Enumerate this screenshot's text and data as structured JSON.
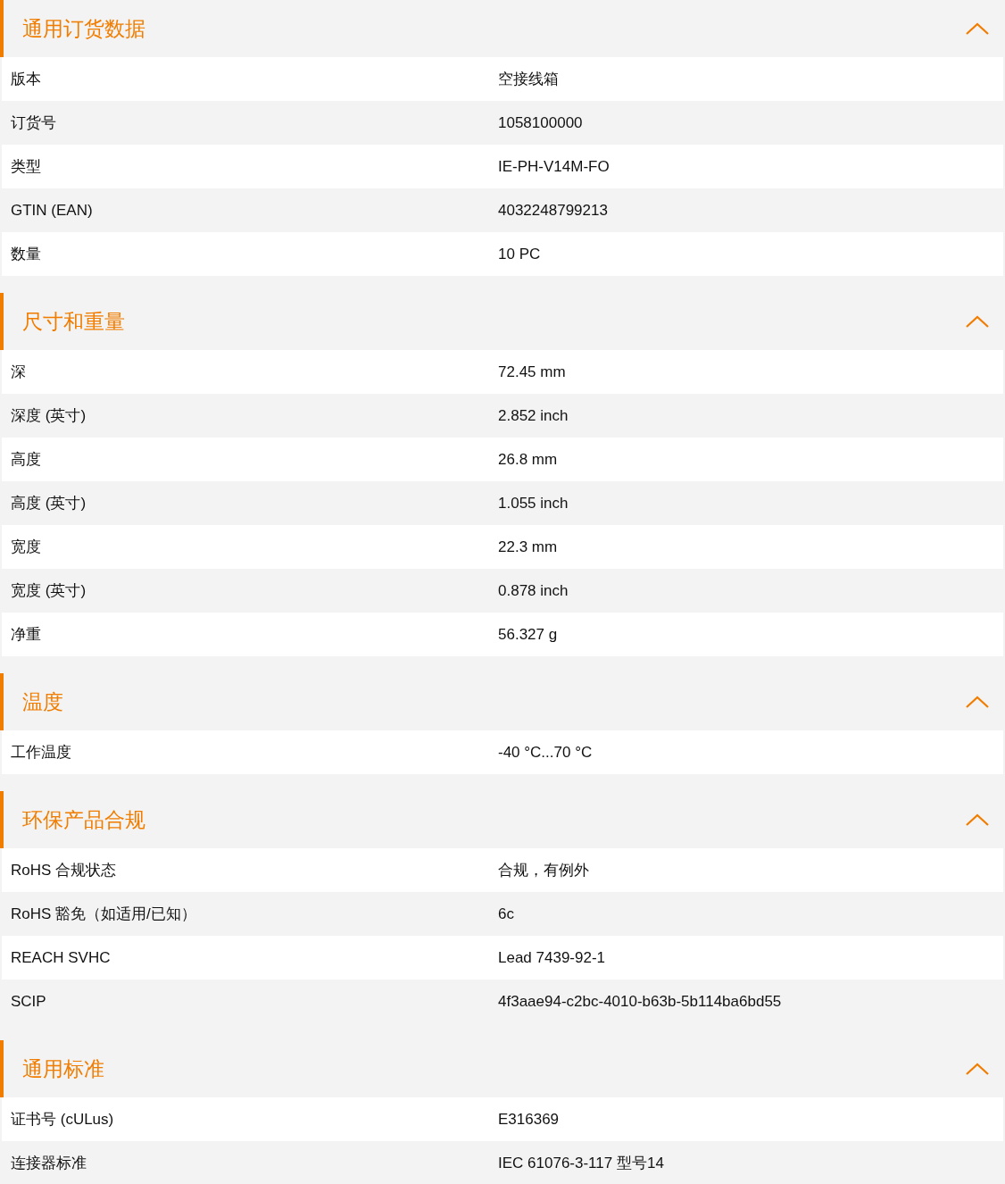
{
  "sections": [
    {
      "title": "通用订货数据",
      "expanded": true,
      "rows": [
        {
          "label": "版本",
          "value": "空接线箱"
        },
        {
          "label": "订货号",
          "value": "1058100000"
        },
        {
          "label": "类型",
          "value": "IE-PH-V14M-FO"
        },
        {
          "label": "GTIN (EAN)",
          "value": "4032248799213"
        },
        {
          "label": "数量",
          "value": "10  PC"
        }
      ]
    },
    {
      "title": "尺寸和重量",
      "expanded": true,
      "rows": [
        {
          "label": "深",
          "value": "72.45  mm"
        },
        {
          "label": "深度 (英寸)",
          "value": "2.852  inch"
        },
        {
          "label": "高度",
          "value": "26.8  mm"
        },
        {
          "label": "高度 (英寸)",
          "value": "1.055  inch"
        },
        {
          "label": "宽度",
          "value": "22.3  mm"
        },
        {
          "label": "宽度 (英寸)",
          "value": "0.878  inch"
        },
        {
          "label": "净重",
          "value": "56.327  g"
        }
      ]
    },
    {
      "title": "温度",
      "expanded": true,
      "rows": [
        {
          "label": "工作温度",
          "value": "-40 °C...70 °C"
        }
      ]
    },
    {
      "title": "环保产品合规",
      "expanded": true,
      "rows": [
        {
          "label": "RoHS 合规状态",
          "value": "合规，有例外"
        },
        {
          "label": "RoHS 豁免（如适用/已知）",
          "value": "6c"
        },
        {
          "label": "REACH SVHC",
          "value": "Lead 7439-92-1"
        },
        {
          "label": "SCIP",
          "value": "4f3aae94-c2bc-4010-b63b-5b114ba6bd55"
        }
      ]
    },
    {
      "title": "通用标准",
      "expanded": true,
      "rows": [
        {
          "label": "证书号 (cULus)",
          "value": "E316369"
        },
        {
          "label": "连接器标准",
          "value": "IEC 61076-3-117 型号14"
        }
      ]
    }
  ]
}
